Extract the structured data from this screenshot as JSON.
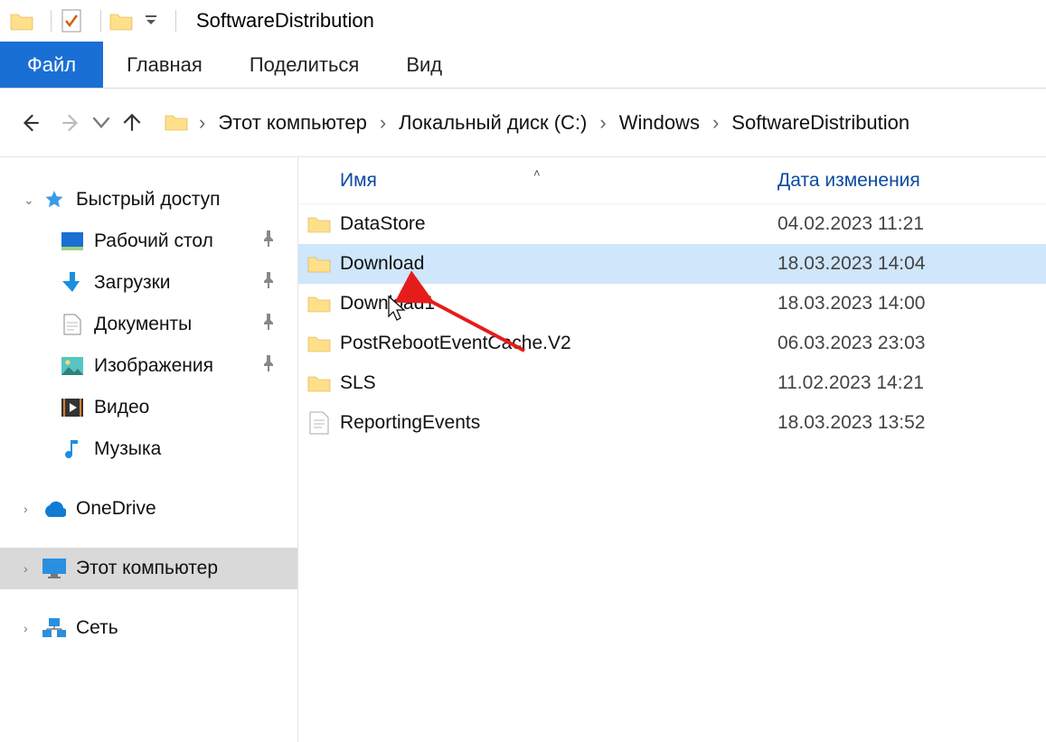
{
  "titlebar": {
    "title": "SoftwareDistribution"
  },
  "ribbon": {
    "file": "Файл",
    "home": "Главная",
    "share": "Поделиться",
    "view": "Вид"
  },
  "breadcrumbs": [
    "Этот компьютер",
    "Локальный диск (C:)",
    "Windows",
    "SoftwareDistribution"
  ],
  "sidebar": {
    "quick_access": "Быстрый доступ",
    "desktop": "Рабочий стол",
    "downloads": "Загрузки",
    "documents": "Документы",
    "pictures": "Изображения",
    "videos": "Видео",
    "music": "Музыка",
    "onedrive": "OneDrive",
    "this_pc": "Этот компьютер",
    "network": "Сеть"
  },
  "columns": {
    "name": "Имя",
    "modified": "Дата изменения"
  },
  "files": [
    {
      "name": "DataStore",
      "modified": "04.02.2023 11:21",
      "type": "folder"
    },
    {
      "name": "Download",
      "modified": "18.03.2023 14:04",
      "type": "folder",
      "selected": true
    },
    {
      "name": "Download1",
      "modified": "18.03.2023 14:00",
      "type": "folder"
    },
    {
      "name": "PostRebootEventCache.V2",
      "modified": "06.03.2023 23:03",
      "type": "folder"
    },
    {
      "name": "SLS",
      "modified": "11.02.2023 14:21",
      "type": "folder"
    },
    {
      "name": "ReportingEvents",
      "modified": "18.03.2023 13:52",
      "type": "text"
    }
  ]
}
